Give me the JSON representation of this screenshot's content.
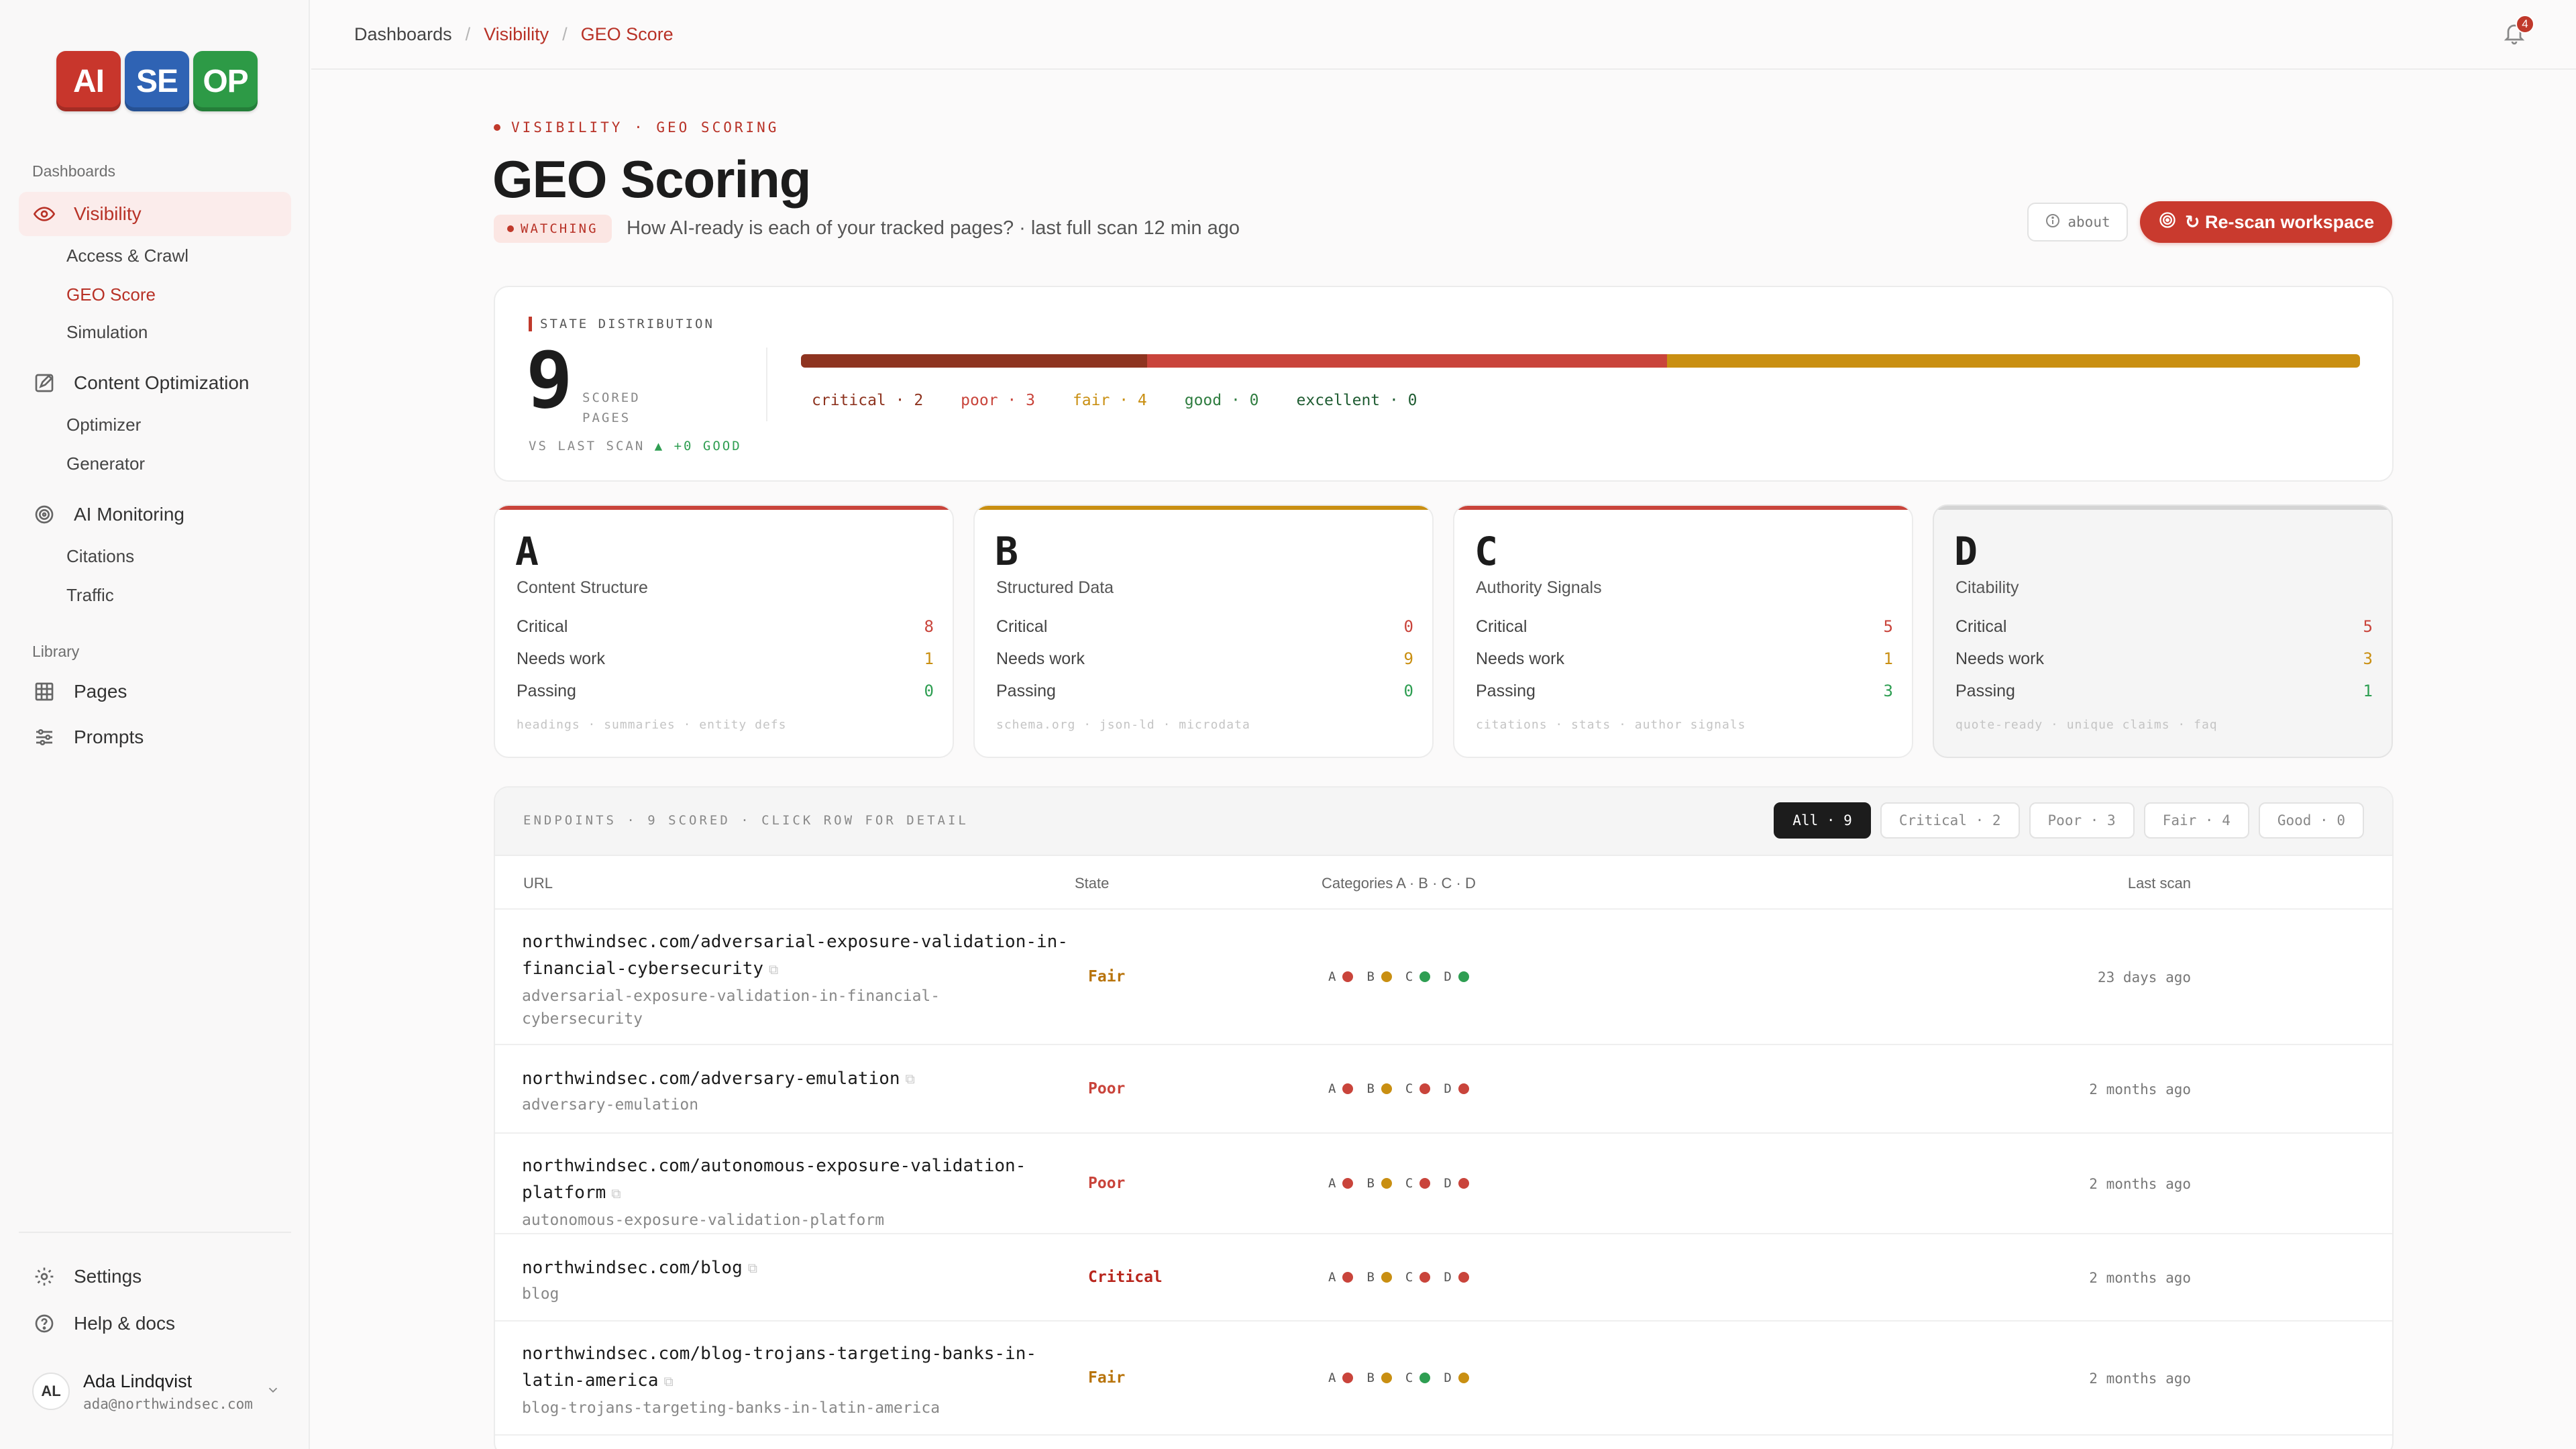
{
  "sidebar": {
    "logo": [
      {
        "text": "AI",
        "color": "#c8362c"
      },
      {
        "text": "SE",
        "color": "#2f63b4"
      },
      {
        "text": "OP",
        "color": "#2d9a46"
      }
    ],
    "section_dashboards": "Dashboards",
    "section_library": "Library",
    "visibility": "Visibility",
    "access_crawl": "Access & Crawl",
    "geo_score": "GEO Score",
    "simulation": "Simulation",
    "content_optimization": "Content Optimization",
    "optimizer": "Optimizer",
    "generator": "Generator",
    "ai_monitoring": "AI Monitoring",
    "citations": "Citations",
    "traffic": "Traffic",
    "pages": "Pages",
    "prompts": "Prompts",
    "settings": "Settings",
    "help": "Help & docs",
    "user": {
      "initials": "AL",
      "name": "Ada Lindqvist",
      "email": "ada@northwindsec.com"
    }
  },
  "topbar": {
    "crumbs": [
      "Dashboards",
      "Visibility",
      "GEO Score"
    ],
    "notifications": "4"
  },
  "header": {
    "eyebrow": "VISIBILITY · GEO SCORING",
    "title": "GEO Scoring",
    "badge": "WATCHING",
    "subtitle": "How AI-ready is each of your tracked pages? · last full scan 12 min ago",
    "about": "about",
    "rescan": "↻ Re-scan workspace"
  },
  "distribution": {
    "label": "STATE DISTRIBUTION",
    "total": "9",
    "scored_line1": "SCORED",
    "scored_line2": "PAGES",
    "vs_label": "VS LAST SCAN",
    "vs_change": "▲ +0 GOOD",
    "segments": [
      {
        "key": "critical",
        "label": "critical · 2",
        "count": 2,
        "color": "#8e3420"
      },
      {
        "key": "poor",
        "label": "poor · 3",
        "count": 3,
        "color": "#c9443b"
      },
      {
        "key": "fair",
        "label": "fair · 4",
        "count": 4,
        "color": "#c98f12"
      },
      {
        "key": "good",
        "label": "good · 0",
        "count": 0,
        "color": "#2f7d40"
      },
      {
        "key": "excellent",
        "label": "excellent · 0",
        "count": 0,
        "color": "#1f5c32"
      }
    ]
  },
  "categories": [
    {
      "letter": "A",
      "name": "Content Structure",
      "critical": "8",
      "needs": "1",
      "passing": "0",
      "hint": "headings · summaries · entity defs",
      "accent": "#c9443b"
    },
    {
      "letter": "B",
      "name": "Structured Data",
      "critical": "0",
      "needs": "9",
      "passing": "0",
      "hint": "schema.org · json-ld · microdata",
      "accent": "#c98f12"
    },
    {
      "letter": "C",
      "name": "Authority Signals",
      "critical": "5",
      "needs": "1",
      "passing": "3",
      "hint": "citations · stats · author signals",
      "accent": "#c9443b"
    },
    {
      "letter": "D",
      "name": "Citability",
      "critical": "5",
      "needs": "3",
      "passing": "1",
      "hint": "quote-ready · unique claims · faq",
      "accent": "#d4d4d4"
    }
  ],
  "category_labels": {
    "critical": "Critical",
    "needs": "Needs work",
    "passing": "Passing"
  },
  "endpoints": {
    "title": "ENDPOINTS · 9 SCORED · CLICK ROW FOR DETAIL",
    "filters": [
      "All · 9",
      "Critical · 2",
      "Poor · 3",
      "Fair · 4",
      "Good · 0"
    ],
    "columns": {
      "url": "URL",
      "state": "State",
      "categories": "Categories A · B · C · D",
      "last_scan": "Last scan"
    },
    "cat_letters": [
      "A",
      "B",
      "C",
      "D"
    ],
    "rows": [
      {
        "url1": "northwindsec.com/adversarial-exposure-validation-in-",
        "url2": "financial-cybersecurity",
        "slug1": "adversarial-exposure-validation-in-financial-",
        "slug2": "cybersecurity",
        "state": "Fair",
        "dots": [
          "#c9443b",
          "#c98f12",
          "#2e9e52",
          "#2e9e52"
        ],
        "time": "23 days ago"
      },
      {
        "url1": "northwindsec.com/adversary-emulation",
        "url2": "",
        "slug1": "adversary-emulation",
        "slug2": "",
        "state": "Poor",
        "dots": [
          "#c9443b",
          "#c98f12",
          "#c9443b",
          "#c9443b"
        ],
        "time": "2 months ago"
      },
      {
        "url1": "northwindsec.com/autonomous-exposure-validation-",
        "url2": "platform",
        "slug1": "autonomous-exposure-validation-platform",
        "slug2": "",
        "state": "Poor",
        "dots": [
          "#c9443b",
          "#c98f12",
          "#c9443b",
          "#c9443b"
        ],
        "time": "2 months ago"
      },
      {
        "url1": "northwindsec.com/blog",
        "url2": "",
        "slug1": "blog",
        "slug2": "",
        "state": "Critical",
        "dots": [
          "#c9443b",
          "#c98f12",
          "#c9443b",
          "#c9443b"
        ],
        "time": "2 months ago"
      },
      {
        "url1": "northwindsec.com/blog-trojans-targeting-banks-in-",
        "url2": "latin-america",
        "slug1": "blog-trojans-targeting-banks-in-latin-america",
        "slug2": "",
        "state": "Fair",
        "dots": [
          "#c9443b",
          "#c98f12",
          "#2e9e52",
          "#c98f12"
        ],
        "time": "2 months ago"
      }
    ]
  },
  "state_colors": {
    "Fair": "#b8740c",
    "Poor": "#c9443b",
    "Critical": "#b8261d"
  }
}
